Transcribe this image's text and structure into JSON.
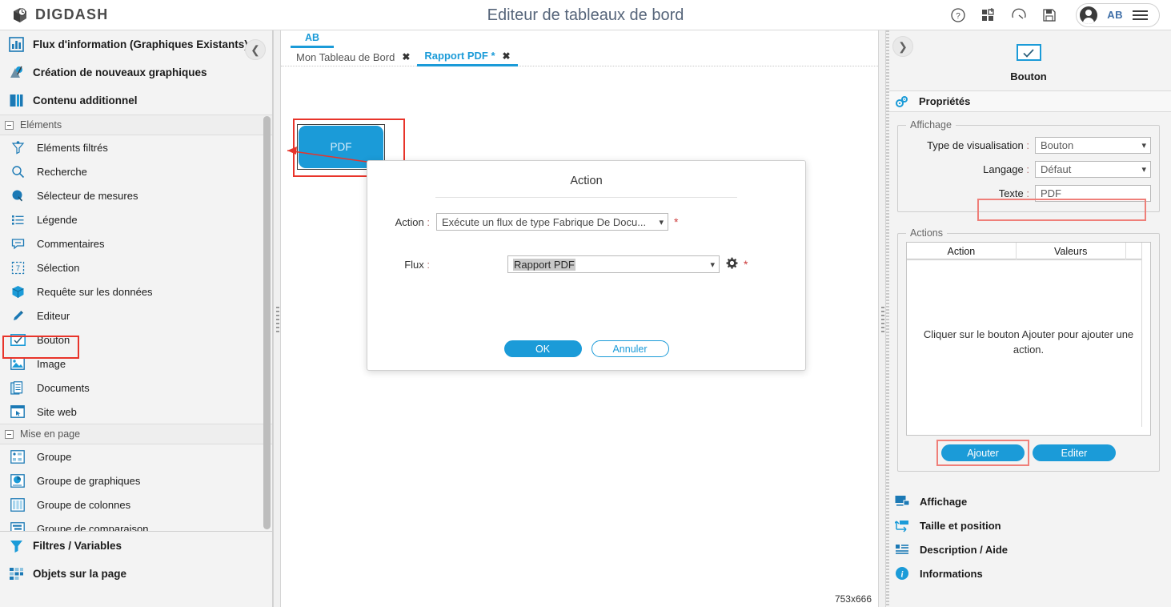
{
  "header": {
    "brand": "DIGDASH",
    "title": "Editeur de tableaux de bord",
    "icons": [
      "help-icon",
      "dashboard-add-icon",
      "performance-icon",
      "save-icon"
    ],
    "user_initials": "AB"
  },
  "sidebar": {
    "main_items": [
      {
        "label": "Flux d'information (Graphiques Existants)",
        "icon": "bar-chart-icon"
      },
      {
        "label": "Création de nouveaux graphiques",
        "icon": "new-chart-icon"
      },
      {
        "label": "Contenu additionnel",
        "icon": "layout-columns-icon"
      }
    ],
    "groups": [
      {
        "label": "Eléments",
        "items": [
          {
            "label": "Eléments filtrés",
            "icon": "filter-funnel-icon"
          },
          {
            "label": "Recherche",
            "icon": "search-icon"
          },
          {
            "label": "Sélecteur de mesures",
            "icon": "measure-selector-icon"
          },
          {
            "label": "Légende",
            "icon": "legend-list-icon"
          },
          {
            "label": "Commentaires",
            "icon": "comment-bubble-icon"
          },
          {
            "label": "Sélection",
            "icon": "selection-marquee-icon"
          },
          {
            "label": "Requête sur les données",
            "icon": "data-cube-icon"
          },
          {
            "label": "Editeur",
            "icon": "pencil-icon"
          },
          {
            "label": "Bouton",
            "icon": "button-check-icon",
            "highlighted": true
          },
          {
            "label": "Image",
            "icon": "image-icon"
          },
          {
            "label": "Documents",
            "icon": "documents-icon"
          },
          {
            "label": "Site web",
            "icon": "website-icon"
          }
        ]
      },
      {
        "label": "Mise en page",
        "items": [
          {
            "label": "Groupe",
            "icon": "group-icon"
          },
          {
            "label": "Groupe de graphiques",
            "icon": "chart-group-icon"
          },
          {
            "label": "Groupe de colonnes",
            "icon": "column-group-icon"
          },
          {
            "label": "Groupe de comparaison",
            "icon": "comparison-group-icon"
          }
        ]
      }
    ],
    "bottom_items": [
      {
        "label": "Filtres / Variables",
        "icon": "filter-icon"
      },
      {
        "label": "Objets sur la page",
        "icon": "page-objects-icon"
      }
    ],
    "collapse_icon": "chevron-left-icon"
  },
  "center": {
    "top_tab": "AB",
    "tabs": [
      {
        "label": "Mon Tableau de Bord",
        "active": false,
        "close_icon": "close-icon"
      },
      {
        "label": "Rapport PDF *",
        "active": true,
        "close_icon": "close-icon"
      }
    ],
    "canvas_button_label": "PDF",
    "size_indicator": "753x666"
  },
  "dialog": {
    "title": "Action",
    "action_label": "Action",
    "action_value": "Exécute un flux de type Fabrique De Docu...",
    "action_required": "*",
    "flux_label": "Flux",
    "flux_value": "Rapport PDF",
    "flux_required": "*",
    "gear_icon": "gear-icon",
    "ok_label": "OK",
    "cancel_label": "Annuler"
  },
  "right_panel": {
    "expand_icon": "chevron-right-icon",
    "type_icon": "button-check-icon",
    "type_label": "Bouton",
    "properties_header": {
      "label": "Propriétés",
      "icon": "properties-gears-icon"
    },
    "affichage": {
      "legend": "Affichage",
      "fields": [
        {
          "label": "Type de visualisation",
          "value": "Bouton",
          "kind": "select"
        },
        {
          "label": "Langage",
          "value": "Défaut",
          "kind": "select"
        },
        {
          "label": "Texte",
          "value": "PDF",
          "kind": "text",
          "highlighted": true
        }
      ]
    },
    "actions": {
      "legend": "Actions",
      "columns": [
        "Action",
        "Valeurs"
      ],
      "empty_message": "Cliquer sur le bouton Ajouter pour ajouter une action.",
      "add_label": "Ajouter",
      "edit_label": "Editer"
    },
    "footer_items": [
      {
        "label": "Affichage",
        "icon": "display-monitor-icon"
      },
      {
        "label": "Taille et position",
        "icon": "size-position-icon"
      },
      {
        "label": "Description / Aide",
        "icon": "description-icon"
      },
      {
        "label": "Informations",
        "icon": "info-icon"
      }
    ]
  },
  "colors": {
    "accent": "#1b9bd8",
    "highlight_red": "#e8342a",
    "highlight_pink": "#ef7f79",
    "panel_bg": "#f3f3f3",
    "title_text": "#56657a"
  }
}
